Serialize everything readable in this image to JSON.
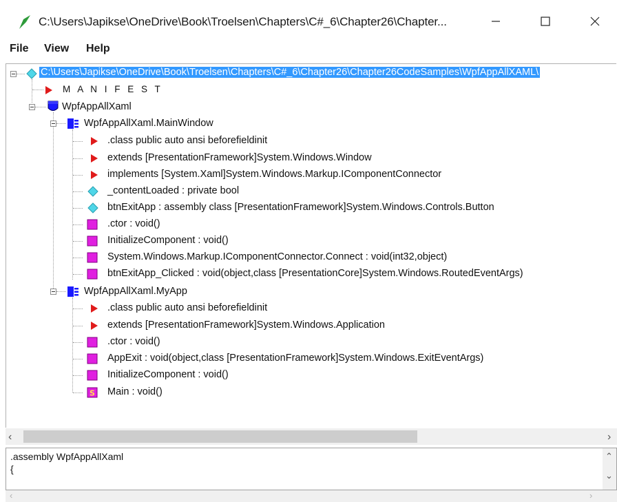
{
  "window": {
    "title": "C:\\Users\\Japikse\\OneDrive\\Book\\Troelsen\\Chapters\\C#_6\\Chapter26\\Chapter...",
    "minimize_icon": "minimize-icon",
    "maximize_icon": "maximize-icon",
    "close_icon": "close-icon"
  },
  "menu": {
    "file": "File",
    "view": "View",
    "help": "Help"
  },
  "tree": {
    "root": "C:\\Users\\Japikse\\OneDrive\\Book\\Troelsen\\Chapters\\C#_6\\Chapter26\\Chapter26CodeSamples\\WpfAppAllXAML\\",
    "manifest": "M A N I F E S T",
    "assembly": "WpfAppAllXaml",
    "mainwindow": {
      "label": "WpfAppAllXaml.MainWindow",
      "items": [
        ".class public auto ansi beforefieldinit",
        "extends [PresentationFramework]System.Windows.Window",
        "implements [System.Xaml]System.Windows.Markup.IComponentConnector",
        "_contentLoaded : private bool",
        "btnExitApp : assembly class [PresentationFramework]System.Windows.Controls.Button",
        ".ctor : void()",
        "InitializeComponent : void()",
        "System.Windows.Markup.IComponentConnector.Connect : void(int32,object)",
        "btnExitApp_Clicked : void(object,class [PresentationCore]System.Windows.RoutedEventArgs)"
      ]
    },
    "myapp": {
      "label": "WpfAppAllXaml.MyApp",
      "items": [
        ".class public auto ansi beforefieldinit",
        "extends [PresentationFramework]System.Windows.Application",
        ".ctor : void()",
        "AppExit : void(object,class [PresentationFramework]System.Windows.ExitEventArgs)",
        "InitializeComponent : void()",
        "Main : void()"
      ]
    }
  },
  "disassembly": {
    "line1": ".assembly WpfAppAllXaml",
    "line2": "{"
  },
  "colors": {
    "selection": "#3399ff",
    "red": "#e01b1b",
    "cyan": "#4fd6e8",
    "magenta": "#e020e0",
    "blue": "#1a1aff"
  }
}
